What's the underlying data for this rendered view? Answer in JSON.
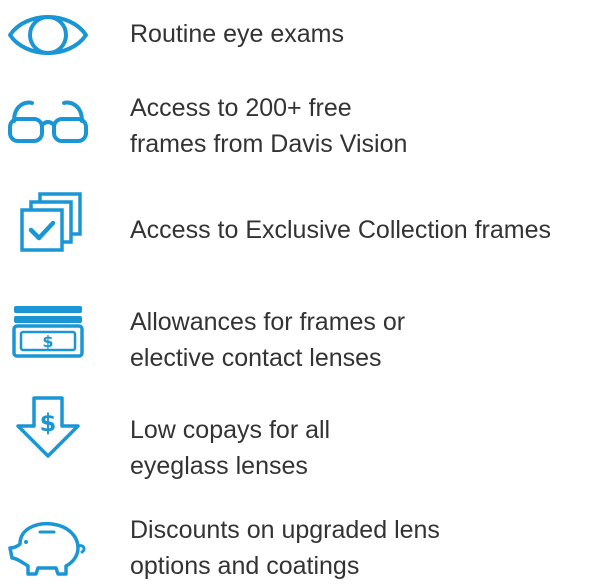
{
  "theme": {
    "icon_color": "#1b96d4",
    "text_color": "#333333",
    "background": "#ffffff"
  },
  "benefits": [
    {
      "icon": "eye-icon",
      "lines": [
        "Routine eye exams"
      ]
    },
    {
      "icon": "glasses-icon",
      "lines": [
        "Access to 200+ free",
        "frames from Davis Vision"
      ]
    },
    {
      "icon": "frames-collection-icon",
      "lines": [
        "Access to Exclusive Collection frames"
      ]
    },
    {
      "icon": "money-allowance-icon",
      "lines": [
        "Allowances for frames or",
        "elective contact lenses"
      ]
    },
    {
      "icon": "low-copay-icon",
      "lines": [
        "Low copays for all",
        "eyeglass lenses"
      ]
    },
    {
      "icon": "piggy-bank-icon",
      "lines": [
        "Discounts on upgraded lens",
        "options and coatings"
      ]
    }
  ]
}
